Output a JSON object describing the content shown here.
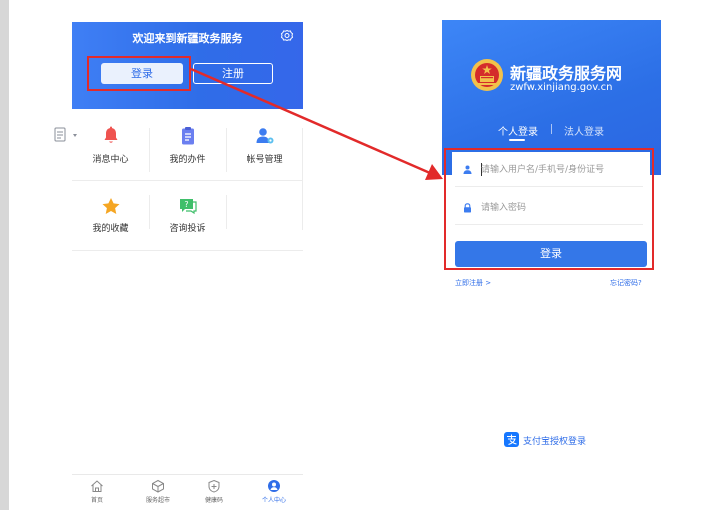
{
  "left_phone": {
    "welcome": "欢迎来到新疆政务服务",
    "login_button": "登录",
    "register_button": "注册",
    "menu": [
      {
        "label": "消息中心",
        "icon": "bell-icon"
      },
      {
        "label": "我的办件",
        "icon": "clipboard-icon"
      },
      {
        "label": "帐号管理",
        "icon": "user-settings-icon"
      },
      {
        "label": "我的收藏",
        "icon": "star-icon"
      },
      {
        "label": "咨询投诉",
        "icon": "chat-question-icon"
      }
    ],
    "bottom_nav": [
      {
        "label": "首页",
        "icon": "home-icon"
      },
      {
        "label": "服务超市",
        "icon": "cube-icon"
      },
      {
        "label": "健康码",
        "icon": "health-code-icon"
      },
      {
        "label": "个人中心",
        "icon": "person-icon",
        "active": true
      }
    ]
  },
  "right_phone": {
    "site_title": "新疆政务服务网",
    "site_domain": "zwfw.xinjiang.gov.cn",
    "tabs": {
      "personal": "个人登录",
      "company": "法人登录"
    },
    "username_placeholder": "请输入用户名/手机号/身份证号",
    "password_placeholder": "请输入密码",
    "login_button": "登录",
    "register_link": "立即注册 >",
    "forgot_link": "忘记密码?",
    "alipay_login": "支付宝授权登录"
  },
  "colors": {
    "brand_blue": "#2f6de8",
    "highlight_red": "#e22a2a"
  }
}
